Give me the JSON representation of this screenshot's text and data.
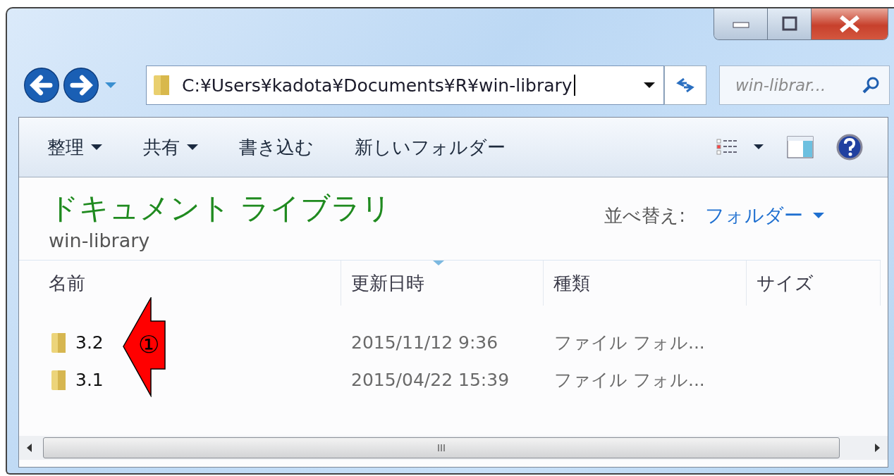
{
  "address": {
    "path": "C:¥Users¥kadota¥Documents¥R¥win-library"
  },
  "search": {
    "placeholder": "win-librar..."
  },
  "toolbar": [
    {
      "label": "整理",
      "has_menu": true
    },
    {
      "label": "共有",
      "has_menu": true
    },
    {
      "label": "書き込む",
      "has_menu": false
    },
    {
      "label": "新しいフォルダー",
      "has_menu": false
    }
  ],
  "library": {
    "title": "ドキュメント ライブラリ",
    "subtitle": "win-library",
    "arrange_label": "並べ替え:",
    "arrange_value": "フォルダー"
  },
  "table": {
    "columns": [
      {
        "label": "名前",
        "sorted": false
      },
      {
        "label": "更新日時",
        "sorted": true
      },
      {
        "label": "種類",
        "sorted": false
      },
      {
        "label": "サイズ",
        "sorted": false
      }
    ],
    "rows": [
      {
        "name": "3.2",
        "modified": "2015/11/12 9:36",
        "type": "ファイル フォル..."
      },
      {
        "name": "3.1",
        "modified": "2015/04/22 15:39",
        "type": "ファイル フォル..."
      }
    ]
  },
  "annotation": {
    "label": "①"
  }
}
